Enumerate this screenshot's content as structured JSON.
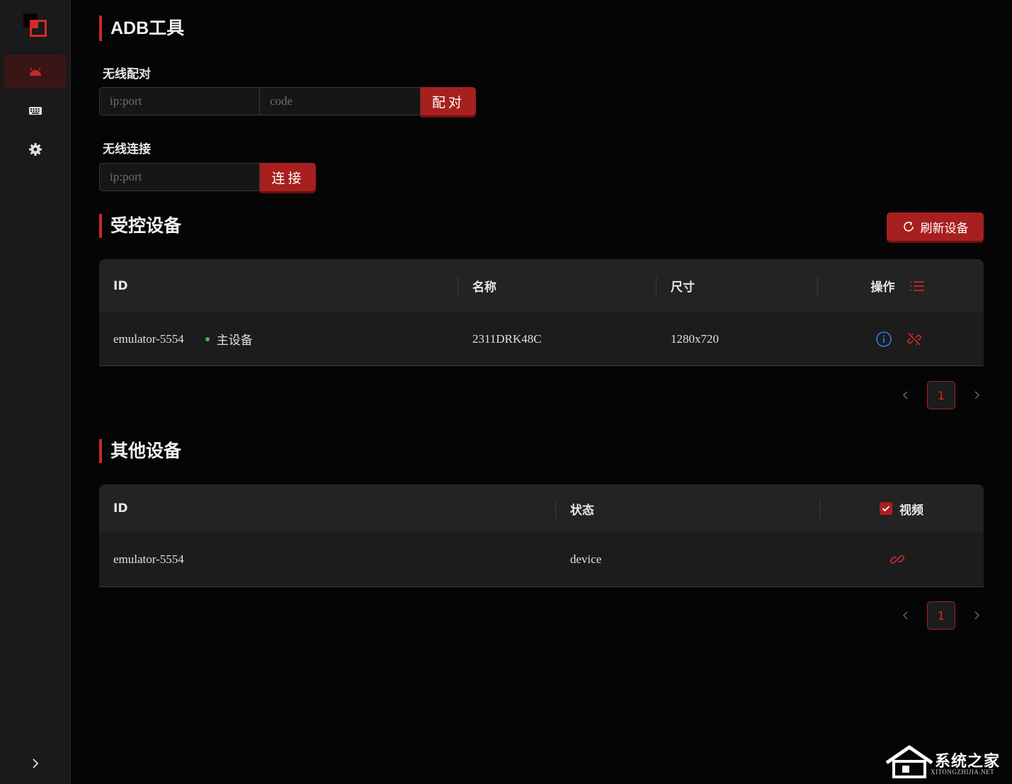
{
  "page": {
    "title": "ADB工具"
  },
  "pair": {
    "label": "无线配对",
    "ip_placeholder": "ip:port",
    "code_placeholder": "code",
    "button": "配对"
  },
  "connect": {
    "label": "无线连接",
    "ip_placeholder": "ip:port",
    "button": "连接"
  },
  "controlled": {
    "title": "受控设备",
    "refresh_button": "刷新设备",
    "columns": {
      "id": "ID",
      "name": "名称",
      "size": "尺寸",
      "actions": "操作"
    },
    "rows": [
      {
        "id": "emulator-5554",
        "status": "主设备",
        "name": "2311DRK48C",
        "size": "1280x720"
      }
    ],
    "page": "1"
  },
  "others": {
    "title": "其他设备",
    "columns": {
      "id": "ID",
      "state": "状态",
      "video": "视频"
    },
    "video_checked": true,
    "rows": [
      {
        "id": "emulator-5554",
        "state": "device"
      }
    ],
    "page": "1"
  },
  "watermark": {
    "text": "系统之家",
    "sub": "XITONGZHIJIA.NET"
  },
  "colors": {
    "accent": "#a81f1f",
    "accent_bright": "#d42a2a",
    "info": "#2f7de1",
    "online": "#4caf50"
  }
}
